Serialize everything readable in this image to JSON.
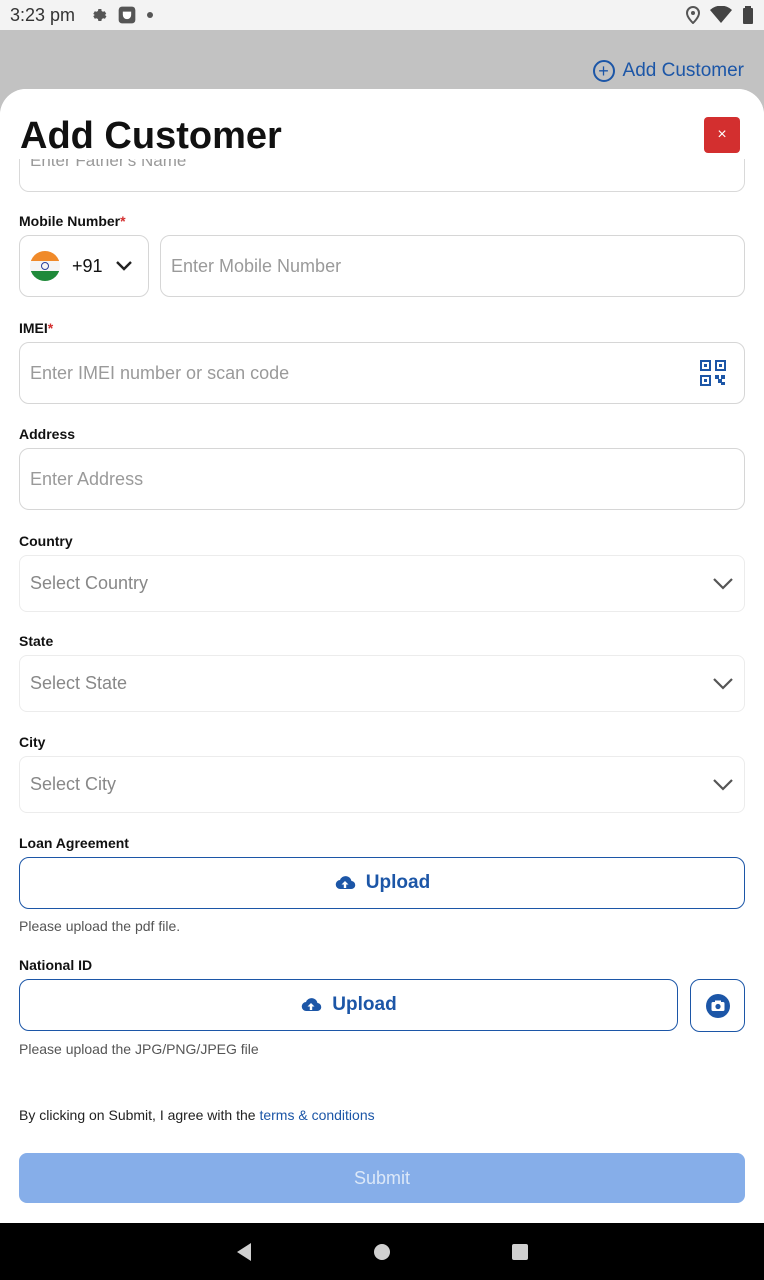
{
  "status_bar": {
    "time": "3:23 pm"
  },
  "background": {
    "add_customer_link": "Add Customer"
  },
  "modal": {
    "title": "Add Customer",
    "close_label": "×",
    "fathers_name": {
      "placeholder": "Enter Father's Name"
    },
    "mobile": {
      "label": "Mobile Number",
      "required_mark": "*",
      "country_code": "+91",
      "placeholder": "Enter Mobile Number"
    },
    "imei": {
      "label": "IMEI",
      "required_mark": "*",
      "placeholder": "Enter IMEI number or scan code"
    },
    "address": {
      "label": "Address",
      "placeholder": "Enter Address"
    },
    "country": {
      "label": "Country",
      "placeholder": "Select Country"
    },
    "state": {
      "label": "State",
      "placeholder": "Select State"
    },
    "city": {
      "label": "City",
      "placeholder": "Select City"
    },
    "loan_agreement": {
      "label": "Loan Agreement",
      "button": "Upload",
      "hint": "Please upload the pdf file."
    },
    "national_id": {
      "label": "National ID",
      "button": "Upload",
      "hint": "Please upload the JPG/PNG/JPEG file"
    },
    "terms": {
      "text": "By clicking on Submit, I agree with the ",
      "link": "terms & conditions"
    },
    "submit_label": "Submit"
  },
  "colors": {
    "accent": "#1c56a7",
    "danger": "#d32f2f",
    "submit_disabled": "#86aee9"
  }
}
